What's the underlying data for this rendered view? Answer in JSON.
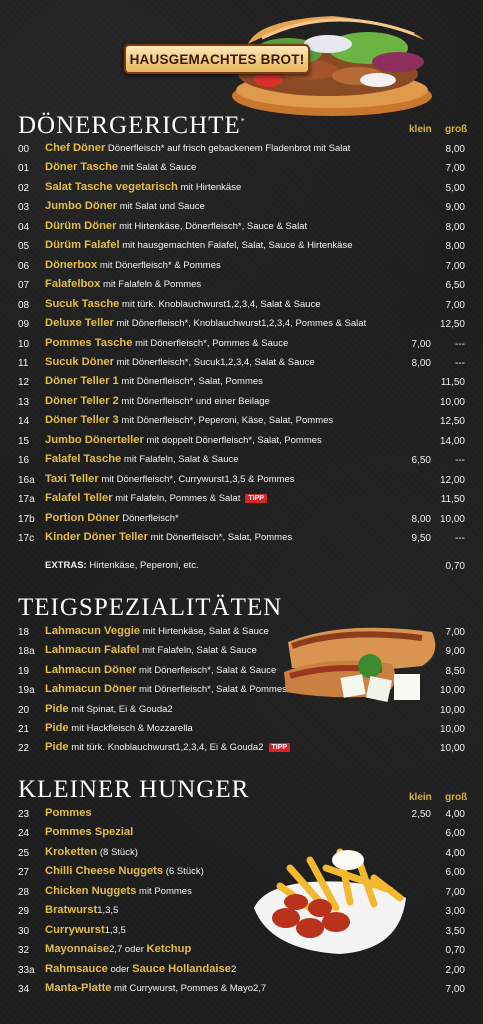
{
  "badge": "HAUSGEMACHTES BROT!",
  "sections": [
    {
      "title": "DÖNERGERICHTE",
      "title_mark": "*",
      "col_klein": "klein",
      "col_gross": "groß",
      "items": [
        {
          "num": "00",
          "title": "Chef Döner",
          "desc": " Dönerfleisch* auf frisch gebackenem Fladenbrot mit Salat",
          "p1": "",
          "p2": "8,00"
        },
        {
          "num": "01",
          "title": "Döner Tasche",
          "desc": " mit Salat & Sauce",
          "p1": "",
          "p2": "7,00"
        },
        {
          "num": "02",
          "title": "Salat Tasche vegetarisch",
          "desc": " mit Hirtenkäse",
          "p1": "",
          "p2": "5,00"
        },
        {
          "num": "03",
          "title": "Jumbo Döner",
          "desc": " mit Salat und Sauce",
          "p1": "",
          "p2": "9,00"
        },
        {
          "num": "04",
          "title": "Dürüm Döner",
          "desc": " mit Hirtenkäse, Dönerfleisch*, Sauce & Salat",
          "p1": "",
          "p2": "8,00"
        },
        {
          "num": "05",
          "title": "Dürüm Falafel",
          "desc": " mit hausgemachten Falafel, Salat, Sauce & Hirtenkäse",
          "p1": "",
          "p2": "8,00"
        },
        {
          "num": "06",
          "title": "Dönerbox",
          "desc": " mit Dönerfleisch* & Pommes",
          "p1": "",
          "p2": "7,00"
        },
        {
          "num": "07",
          "title": "Falafelbox",
          "desc": " mit Falafeln & Pommes",
          "p1": "",
          "p2": "6,50"
        },
        {
          "num": "08",
          "title": "Sucuk Tasche",
          "desc": " mit türk. Knoblauchwurst1,2,3,4, Salat & Sauce",
          "p1": "",
          "p2": "7,00"
        },
        {
          "num": "09",
          "title": "Deluxe Teller",
          "desc": " mit Dönerfleisch*, Knoblauchwurst1,2,3,4,  Pommes & Salat",
          "p1": "",
          "p2": "12,50"
        },
        {
          "num": "10",
          "title": "Pommes Tasche",
          "desc": " mit Dönerfleisch*, Pommes & Sauce",
          "p1": "7,00",
          "p2": "---"
        },
        {
          "num": "11",
          "title": "Sucuk Döner",
          "desc": " mit Dönerfleisch*, Sucuk1,2,3,4, Salat & Sauce",
          "p1": "8,00",
          "p2": "---"
        },
        {
          "num": "12",
          "title": "Döner Teller 1",
          "desc": " mit Dönerfleisch*, Salat, Pommes",
          "p1": "",
          "p2": "11,50"
        },
        {
          "num": "13",
          "title": "Döner Teller 2",
          "desc": " mit Dönerfleisch* und einer Beilage",
          "p1": "",
          "p2": "10,00"
        },
        {
          "num": "14",
          "title": "Döner Teller 3",
          "desc": " mit Dönerfleisch*, Peperoni, Käse, Salat, Pommes",
          "p1": "",
          "p2": "12,50"
        },
        {
          "num": "15",
          "title": "Jumbo Dönerteller",
          "desc": " mit doppelt Dönerfleisch*, Salat, Pommes",
          "p1": "",
          "p2": "14,00"
        },
        {
          "num": "16",
          "title": "Falafel Tasche",
          "desc": " mit Falafeln, Salat & Sauce",
          "p1": "6,50",
          "p2": "---"
        },
        {
          "num": "16a",
          "title": "Taxi Teller",
          "desc": " mit Dönerfleisch*, Currywurst1,3,5 & Pommes",
          "p1": "",
          "p2": "12,00"
        },
        {
          "num": "17a",
          "title": "Falafel Teller",
          "desc": " mit Falafeln, Pommes & Salat",
          "tipp": "TIPP",
          "p1": "",
          "p2": "11,50"
        },
        {
          "num": "17b",
          "title": "Portion Döner",
          "desc": " Dönerfleisch*",
          "p1": "8,00",
          "p2": "10,00"
        },
        {
          "num": "17c",
          "title": "Kinder Döner Teller",
          "desc": " mit Dönerfleisch*, Salat, Pommes",
          "p1": "9,50",
          "p2": "---"
        }
      ],
      "extras_label": "EXTRAS:",
      "extras_text": " Hirtenkäse, Peperoni, etc.",
      "extras_price": "0,70"
    },
    {
      "title": "TEIGSPEZIALITÄTEN",
      "items": [
        {
          "num": "18",
          "title": "Lahmacun Veggie",
          "desc": " mit Hirtenkäse, Salat & Sauce",
          "p1": "",
          "p2": "7,00"
        },
        {
          "num": "18a",
          "title": "Lahmacun Falafel",
          "desc": " mit Falafeln, Salat & Sauce",
          "p1": "",
          "p2": "9,00"
        },
        {
          "num": "19",
          "title": "Lahmacun Döner",
          "desc": " mit Dönerfleisch*, Salat & Sauce",
          "p1": "",
          "p2": "8,50"
        },
        {
          "num": "19a",
          "title": "Lahmacun Döner",
          "desc": " mit Dönerfleisch*, Salat & Pommes",
          "p1": "",
          "p2": "10,00"
        },
        {
          "num": "20",
          "title": "Pide",
          "desc": " mit Spinat, Ei & Gouda2",
          "p1": "",
          "p2": "10,00"
        },
        {
          "num": "21",
          "title": "Pide",
          "desc": " mit Hackfleisch & Mozzarella",
          "p1": "",
          "p2": "10,00"
        },
        {
          "num": "22",
          "title": "Pide",
          "desc": " mit türk. Knoblauchwurst1,2,3,4, Ei & Gouda2",
          "tipp": "TIPP",
          "p1": "",
          "p2": "10,00"
        }
      ]
    },
    {
      "title": "KLEINER HUNGER",
      "col_klein": "klein",
      "col_gross": "groß",
      "items": [
        {
          "num": "23",
          "title": "Pommes",
          "desc": "",
          "p1": "2,50",
          "p2": "4,00"
        },
        {
          "num": "24",
          "title": "Pommes Spezial",
          "desc": "",
          "p1": "",
          "p2": "6,00"
        },
        {
          "num": "25",
          "title": "Kroketten",
          "desc": " (8 Stück)",
          "p1": "",
          "p2": "4,00"
        },
        {
          "num": "27",
          "title": "Chilli Cheese Nuggets",
          "desc": " (6 Stück)",
          "p1": "",
          "p2": "6,00"
        },
        {
          "num": "28",
          "title": "Chicken Nuggets",
          "desc": " mit Pommes",
          "p1": "",
          "p2": "7,00"
        },
        {
          "num": "29",
          "title": "Bratwurst",
          "desc": "1,3,5",
          "p1": "",
          "p2": "3,00"
        },
        {
          "num": "30",
          "title": "Currywurst",
          "desc": "1,3,5",
          "p1": "",
          "p2": "3,50"
        },
        {
          "num": "32",
          "title": "Mayonnaise",
          "desc": "2,7 oder ",
          "title2": "Ketchup",
          "p1": "",
          "p2": "0,70"
        },
        {
          "num": "33a",
          "title": "Rahmsauce",
          "desc": " oder ",
          "title2": "Sauce Hollandaise",
          "desc2": "2",
          "p1": "",
          "p2": "2,00"
        },
        {
          "num": "34",
          "title": "Manta-Platte",
          "desc": " mit Currywurst, Pommes & Mayo2,7",
          "p1": "",
          "p2": "7,00"
        }
      ]
    }
  ]
}
